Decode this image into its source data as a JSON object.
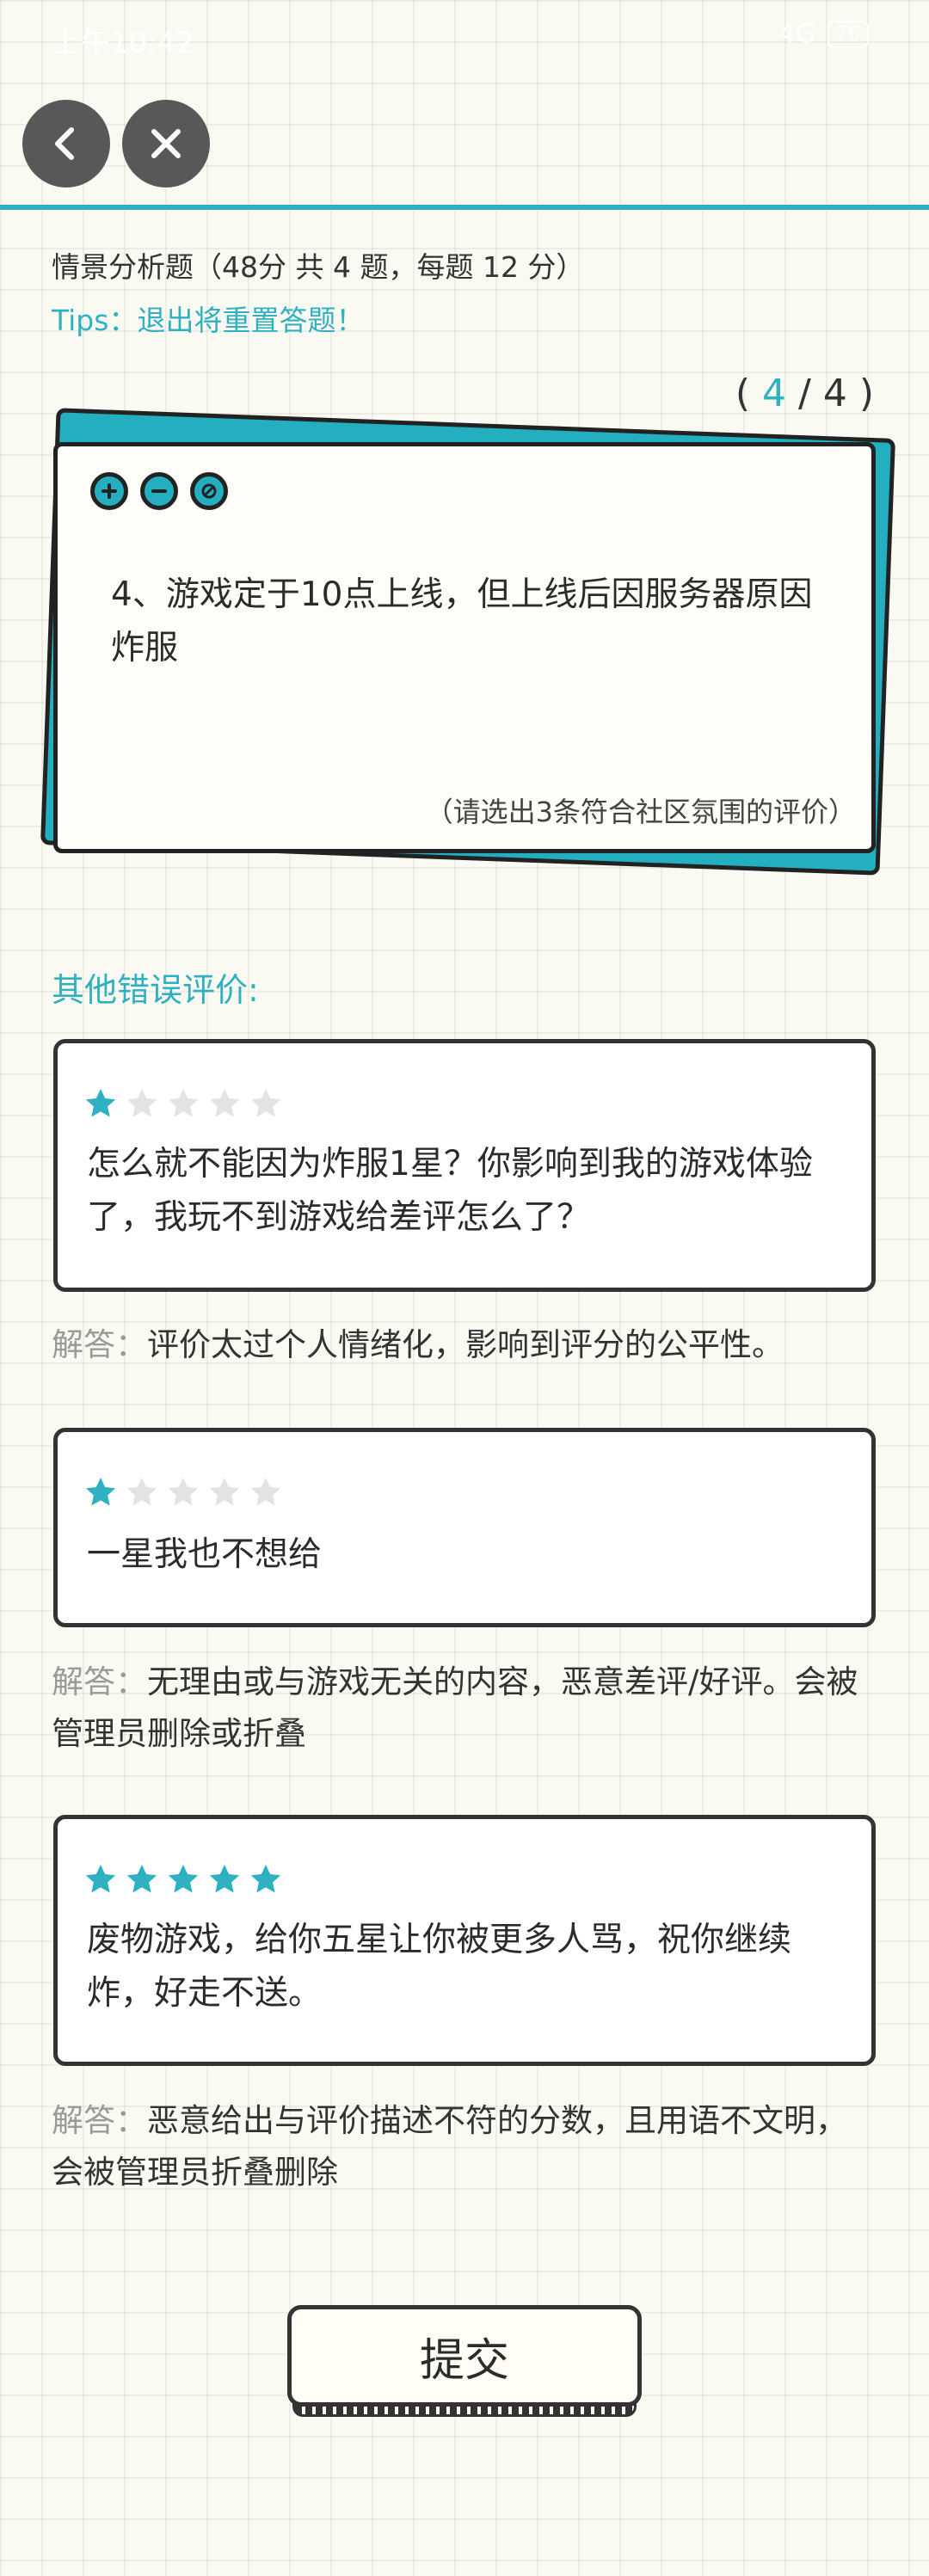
{
  "status_bar": {
    "time": "上午10:42",
    "network": "4G",
    "battery": "76"
  },
  "nav": {
    "back_icon": "chevron-left-icon",
    "close_icon": "close-icon"
  },
  "header": {
    "section_title": "情景分析题（48分 共 4 题，每题 12 分）",
    "tips": "Tips：退出将重置答题！"
  },
  "progress": {
    "open": "( ",
    "current": "4",
    "sep": " / ",
    "total": "4",
    "close": " )"
  },
  "question": {
    "text": "4、游戏定于10点上线，但上线后因服务器原因炸服",
    "hint": "（请选出3条符合社区氛围的评价）",
    "icons": [
      "zoom-in-icon",
      "zoom-out-icon",
      "block-icon"
    ]
  },
  "others_title": "其他错误评价:",
  "reviews": [
    {
      "stars": 1,
      "text": "怎么就不能因为炸服1星？你影响到我的游戏体验了，我玩不到游戏给差评怎么了？"
    },
    {
      "stars": 1,
      "text": "一星我也不想给"
    },
    {
      "stars": 5,
      "text": "废物游戏，给你五星让你被更多人骂，祝你继续炸，好走不送。"
    }
  ],
  "answers": [
    {
      "label": "解答：",
      "text": "评价太过个人情绪化，影响到评分的公平性。"
    },
    {
      "label": "解答：",
      "text": "无理由或与游戏无关的内容，恶意差评/好评。会被管理员删除或折叠"
    },
    {
      "label": "解答：",
      "text": "恶意给出与评价描述不符的分数，且用语不文明，会被管理员折叠删除"
    }
  ],
  "submit_label": "提交",
  "colors": {
    "accent": "#2fb1c1",
    "star_on": "#2fb1c1",
    "star_off": "#e3e3e3"
  }
}
